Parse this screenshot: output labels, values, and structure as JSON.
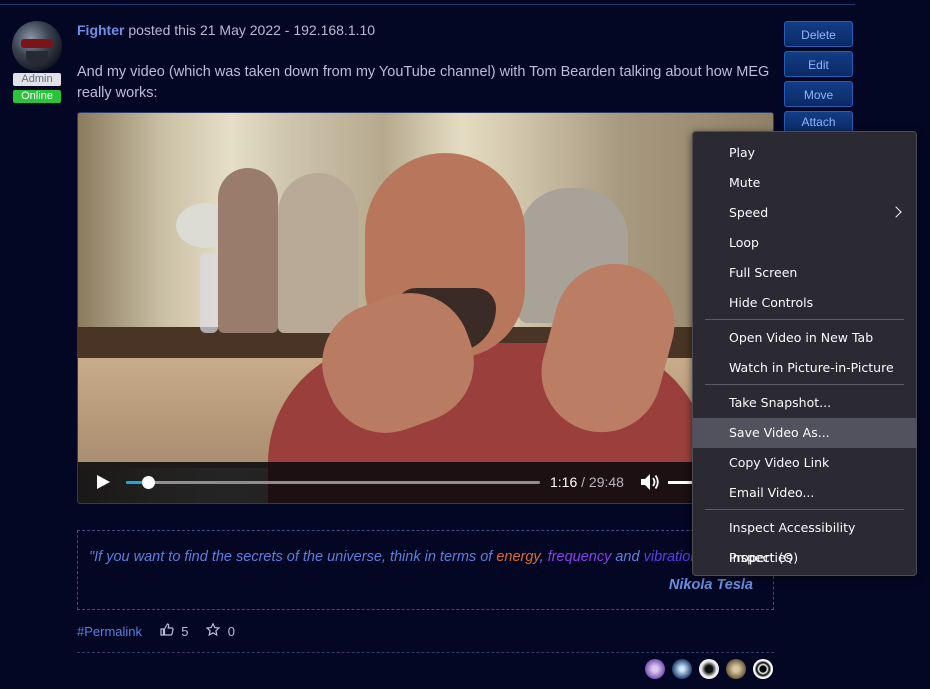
{
  "post": {
    "author": "Fighter",
    "meta": "posted this 21 May 2022 - 192.168.1.10",
    "text": "And my video (which was taken down from my YouTube channel) with Tom Bearden talking about how MEG really works:",
    "badges": {
      "role": "Admin",
      "status": "Online"
    }
  },
  "actions": {
    "delete": "Delete",
    "edit": "Edit",
    "move": "Move",
    "attach": "Attach"
  },
  "video": {
    "current_time": "1:16",
    "duration": "/ 29:48",
    "progress": 0.043
  },
  "quote": {
    "part1": "\"If you want to find the secrets of the universe, think in terms of ",
    "energy": "energy",
    "comma": ", ",
    "frequency": "frequency",
    "and": " and ",
    "vibration": "vibration",
    "author": "Nikola Tesla"
  },
  "footer": {
    "permalink": "#Permalink",
    "likes": "5",
    "stars": "0"
  },
  "context_menu": {
    "items": [
      {
        "label": "Play"
      },
      {
        "label": "Mute"
      },
      {
        "label": "Speed"
      },
      {
        "label": "Loop"
      },
      {
        "label": "Full Screen"
      },
      {
        "label": "Hide Controls"
      },
      {
        "label": "Open Video in New Tab"
      },
      {
        "label": "Watch in Picture-in-Picture"
      },
      {
        "label": "Take Snapshot..."
      },
      {
        "label": "Save Video As..."
      },
      {
        "label": "Copy Video Link"
      },
      {
        "label": "Email Video..."
      },
      {
        "label": "Inspect Accessibility Properties"
      },
      {
        "label": "Inspect (Q)"
      }
    ]
  },
  "colors": {
    "background": "#030724",
    "accent": "#19a7e0",
    "online": "#2bc339",
    "menu_bg": "#2b2a33"
  }
}
